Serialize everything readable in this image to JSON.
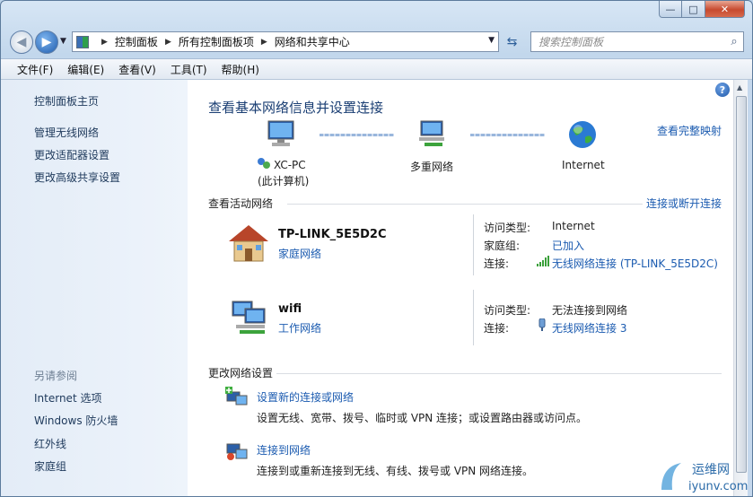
{
  "window": {
    "caption_min": "—",
    "caption_max": "□",
    "caption_close": "✕"
  },
  "address_bar": {
    "crumbs": [
      "控制面板",
      "所有控制面板项",
      "网络和共享中心"
    ]
  },
  "search": {
    "placeholder": "搜索控制面板"
  },
  "menu": [
    "文件(F)",
    "编辑(E)",
    "查看(V)",
    "工具(T)",
    "帮助(H)"
  ],
  "sidebar": {
    "home": "控制面板主页",
    "links": [
      "管理无线网络",
      "更改适配器设置",
      "更改高级共享设置"
    ],
    "see_also_heading": "另请参阅",
    "see_also": [
      "Internet 选项",
      "Windows 防火墙",
      "红外线",
      "家庭组"
    ]
  },
  "main": {
    "title": "查看基本网络信息并设置连接",
    "full_map_link": "查看完整映射",
    "map": {
      "computer_name": "XC-PC",
      "computer_sub": "(此计算机)",
      "middle": "多重网络",
      "internet": "Internet"
    },
    "active_header": "查看活动网络",
    "connect_disconnect": "连接或断开连接",
    "networks": [
      {
        "name": "TP-LINK_5E5D2C",
        "type": "家庭网络",
        "rows": [
          {
            "label": "访问类型:",
            "value": "Internet"
          },
          {
            "label": "家庭组:",
            "value": "已加入"
          },
          {
            "label": "连接:",
            "value": "无线网络连接 (TP-LINK_5E5D2C)"
          }
        ]
      },
      {
        "name": "wifi",
        "type": "工作网络",
        "rows": [
          {
            "label": "访问类型:",
            "value": "无法连接到网络"
          },
          {
            "label": "连接:",
            "value": "无线网络连接 3"
          }
        ]
      }
    ],
    "change_header": "更改网络设置",
    "tasks": [
      {
        "title": "设置新的连接或网络",
        "desc": "设置无线、宽带、拨号、临时或 VPN 连接；或设置路由器或访问点。"
      },
      {
        "title": "连接到网络",
        "desc": "连接到或重新连接到无线、有线、拨号或 VPN 网络连接。"
      }
    ]
  },
  "watermark": {
    "cn": "运维网",
    "en": "iyunv.com"
  },
  "colors": {
    "link": "#1b5bb0",
    "title": "#1a3e73",
    "sidebar_bg": "#e3ecf7"
  }
}
